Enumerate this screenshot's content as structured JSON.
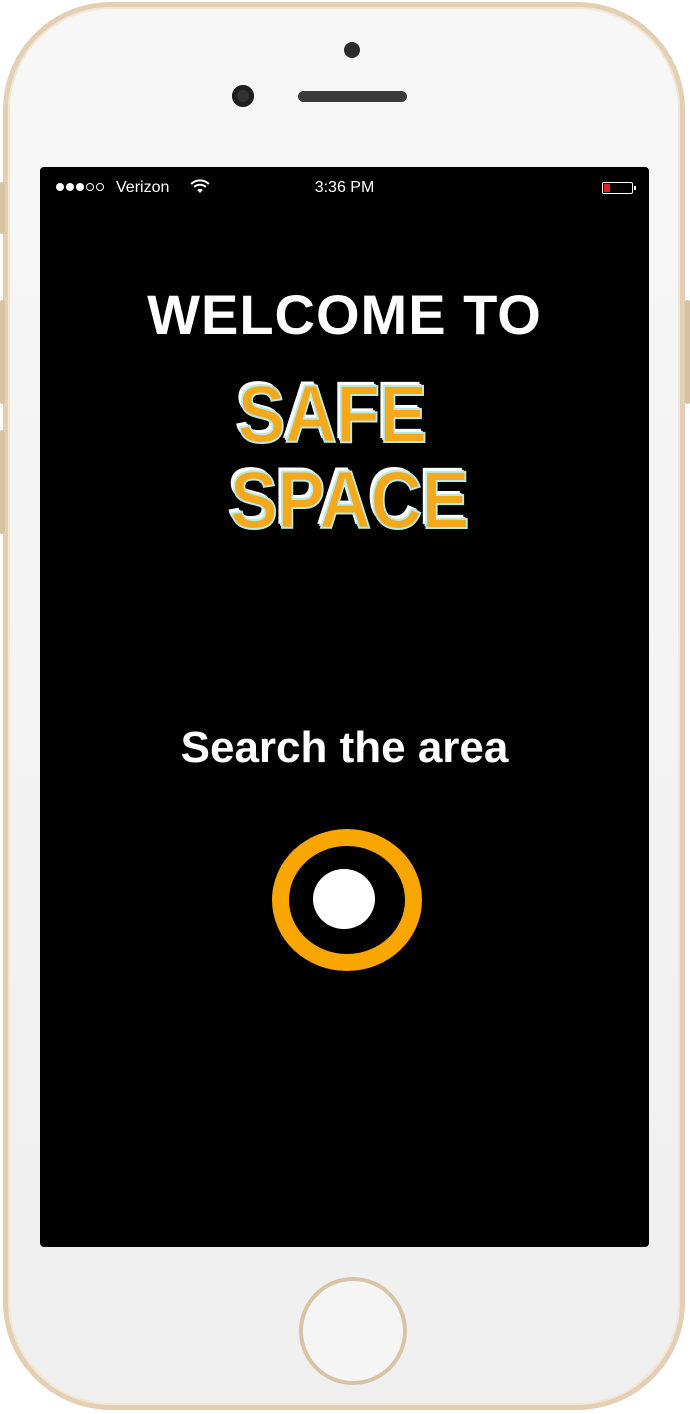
{
  "status_bar": {
    "carrier": "Verizon",
    "time": "3:36 PM",
    "signal_bars_filled": 3,
    "signal_bars_total": 5,
    "battery_level": "low",
    "battery_color": "#e02020",
    "wifi_icon": "wifi-icon"
  },
  "main": {
    "welcome_text": "WELCOME TO",
    "logo": {
      "line1": "SAFE",
      "line2": "SPACE",
      "color": "#f4a81c"
    },
    "search_label": "Search the area",
    "search_button_icon": "record-circle-icon",
    "accent_color": "#f9a700"
  }
}
